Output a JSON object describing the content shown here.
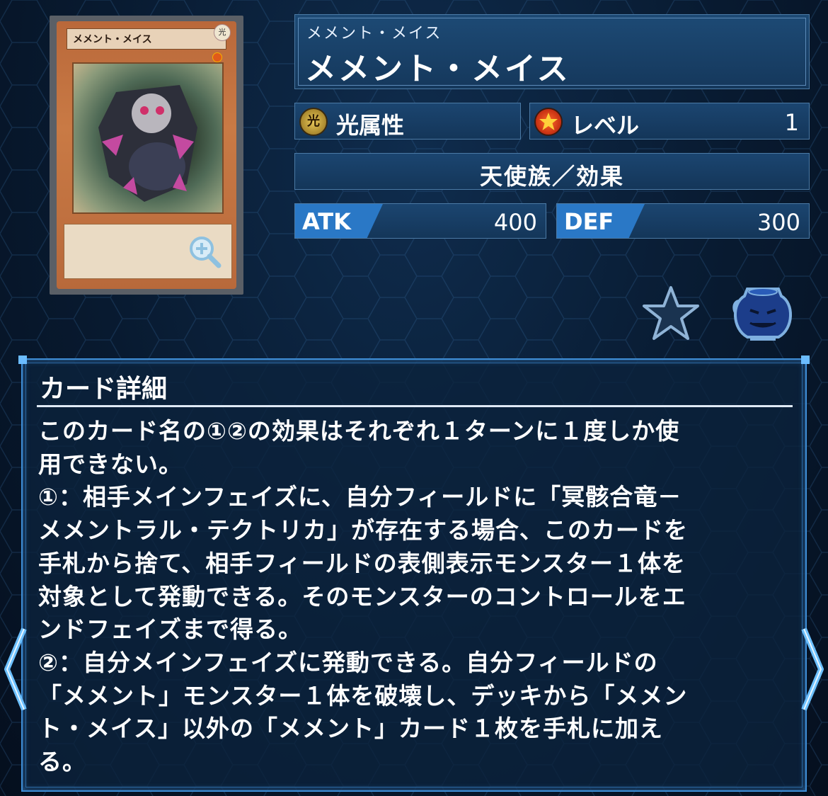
{
  "card_image": {
    "name_bar": "メメント・メイス",
    "attribute_mark": "光"
  },
  "header": {
    "ruby": "メメント・メイス",
    "title": "メメント・メイス"
  },
  "attribute": {
    "icon_glyph": "光",
    "label": "光属性"
  },
  "level": {
    "label": "レベル",
    "value": "1"
  },
  "type": {
    "label": "天使族／効果"
  },
  "stats": {
    "atk_label": "ATK",
    "atk_value": "400",
    "def_label": "DEF",
    "def_value": "300"
  },
  "actions": {
    "favorite_icon": "star-icon",
    "deck_icon": "pot-of-greed-icon"
  },
  "description": {
    "heading": "カード詳細",
    "text": "このカード名の①②の効果はそれぞれ１ターンに１度しか使\n用できない。\n①：相手メインフェイズに、自分フィールドに「冥骸合竜－\nメメントラル・テクトリカ」が存在する場合、このカードを\n手札から捨て、相手フィールドの表側表示モンスター１体を\n対象として発動できる。そのモンスターのコントロールをエ\nンドフェイズまで得る。\n②：自分メインフェイズに発動できる。自分フィールドの\n「メメント」モンスター１体を破壊し、デッキから「メメン\nト・メイス」以外の「メメント」カード１枚を手札に加え\nる。"
  },
  "navigation": {
    "prev_icon": "chevron-left-icon",
    "next_icon": "chevron-right-icon"
  },
  "colors": {
    "accent": "#2a78c6",
    "frame": "#3f8fd8",
    "panel": "#1b4570"
  }
}
